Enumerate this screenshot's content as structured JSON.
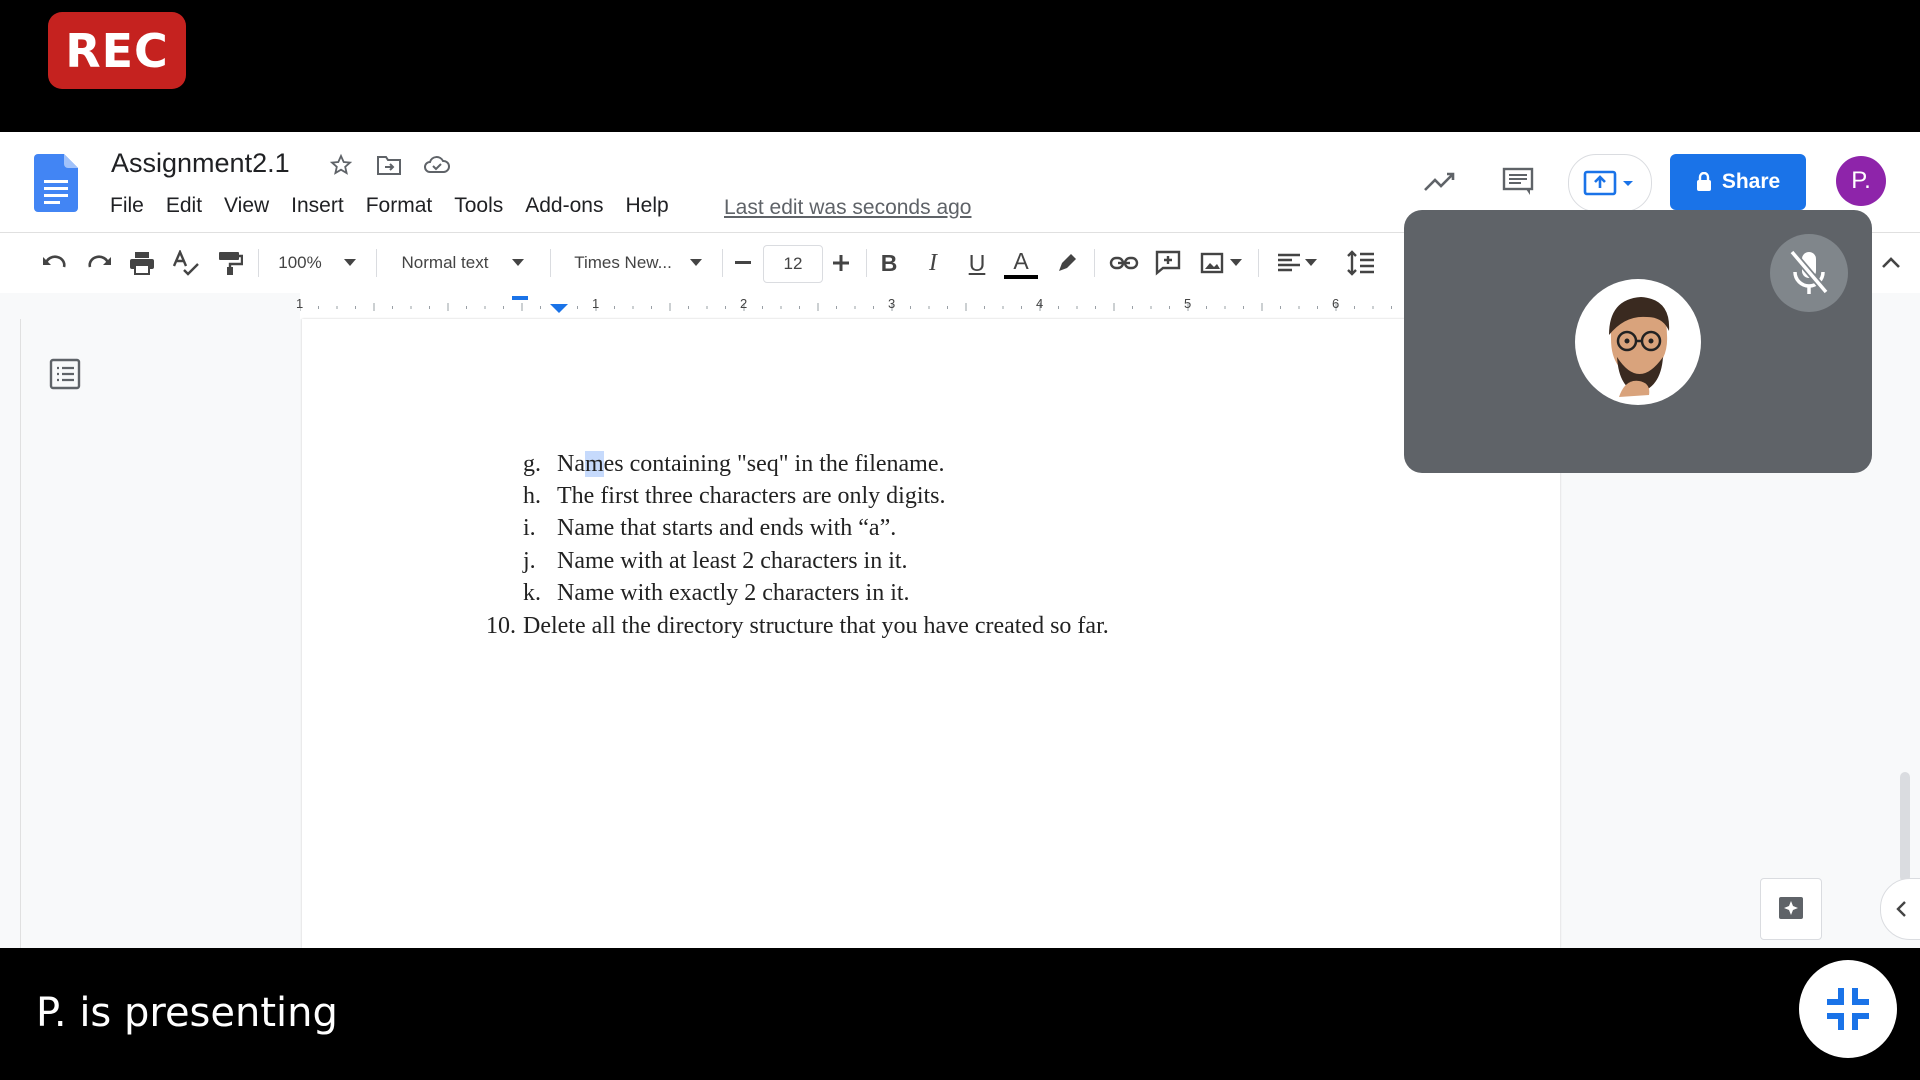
{
  "recording": {
    "label": "REC"
  },
  "document": {
    "title": "Assignment2.1",
    "last_edit": "Last edit was seconds ago"
  },
  "menu": [
    "File",
    "Edit",
    "View",
    "Insert",
    "Format",
    "Tools",
    "Add-ons",
    "Help"
  ],
  "header_actions": {
    "share_label": "Share",
    "avatar_letter": "P."
  },
  "toolbar": {
    "zoom": "100%",
    "style": "Normal text",
    "font": "Times New...",
    "font_size": "12",
    "bold": "B",
    "italic": "I",
    "underline": "U",
    "text_color": "A"
  },
  "ruler": {
    "numbers": [
      "1",
      "1",
      "2",
      "3",
      "4",
      "5",
      "6"
    ]
  },
  "content": {
    "items": [
      {
        "marker": "g.",
        "text_before": "Na",
        "selected": "m",
        "text_after": "es containing \"seq\" in the filename."
      },
      {
        "marker": "h.",
        "text": "The first three characters are only digits."
      },
      {
        "marker": "i.",
        "text": "Name that starts and ends with “a”."
      },
      {
        "marker": "j.",
        "text": "Name with at least 2 characters in it."
      },
      {
        "marker": "k.",
        "text": "Name with exactly 2 characters in it."
      },
      {
        "marker": "10.",
        "text": "Delete all the directory structure that you have created so far."
      }
    ]
  },
  "meeting": {
    "presenting_text": "P. is presenting"
  },
  "colors": {
    "rec": "#c5221f",
    "share": "#1a73e8",
    "avatar": "#8e24aa",
    "tile": "#5f6368",
    "collapse_icon": "#1a73e8"
  }
}
